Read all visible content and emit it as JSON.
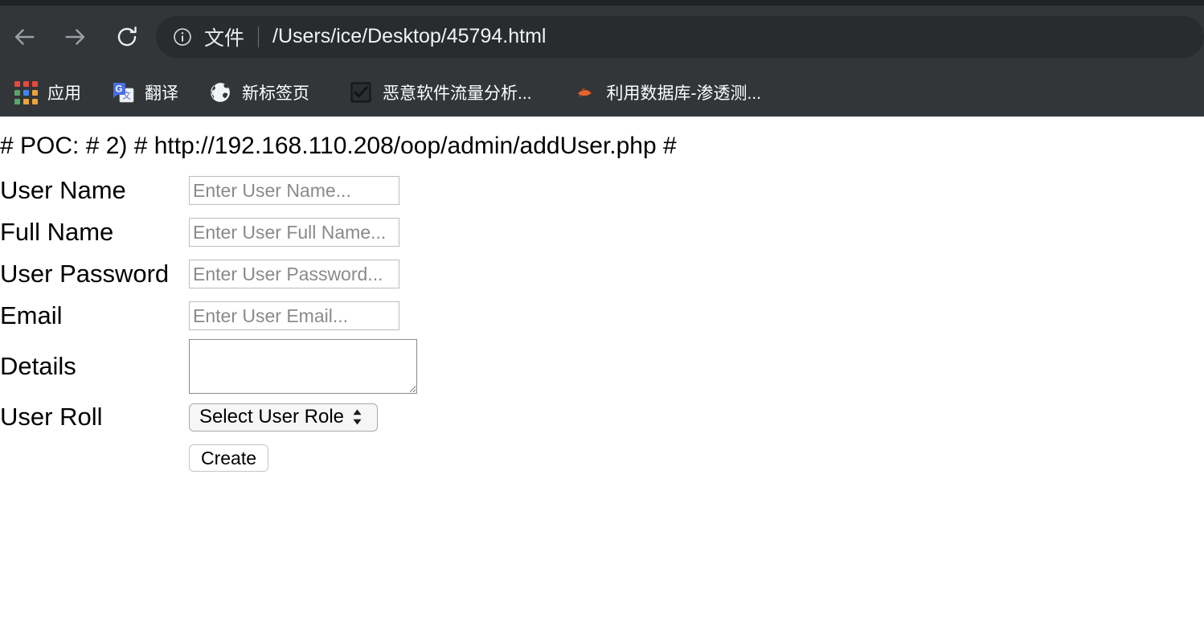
{
  "browser": {
    "nav": {
      "back_label": "Back",
      "forward_label": "Forward",
      "reload_label": "Reload"
    },
    "omnibox": {
      "info_icon": "info-circle-icon",
      "scheme_label": "文件",
      "url": "/Users/ice/Desktop/45794.html"
    },
    "bookmarks": [
      {
        "icon": "apps-grid-icon",
        "label": "应用"
      },
      {
        "icon": "google-translate-icon",
        "label": "翻译"
      },
      {
        "icon": "globe-icon",
        "label": "新标签页"
      },
      {
        "icon": "checkbox-checked-icon",
        "label": "恶意软件流量分析..."
      },
      {
        "icon": "orange-flame-icon",
        "label": "利用数据库-渗透测..."
      }
    ]
  },
  "page": {
    "heading": "# POC: # 2) # http://192.168.110.208/oop/admin/addUser.php #",
    "fields": [
      {
        "label": "User Name",
        "placeholder": "Enter User Name...",
        "value": "",
        "type": "text"
      },
      {
        "label": "Full Name",
        "placeholder": "Enter User Full Name...",
        "value": "",
        "type": "text"
      },
      {
        "label": "User Password",
        "placeholder": "Enter User Password...",
        "value": "",
        "type": "text"
      },
      {
        "label": "Email",
        "placeholder": "Enter User Email...",
        "value": "",
        "type": "text"
      }
    ],
    "details": {
      "label": "Details",
      "value": "",
      "placeholder": ""
    },
    "user_roll": {
      "label": "User Roll",
      "selected": "Select User Role"
    },
    "submit": {
      "label": "Create"
    }
  },
  "colors": {
    "chrome_bg": "#323639",
    "titlebar": "#202324",
    "omnibox_bg": "#292c2e",
    "text_on_chrome": "#ffffff",
    "page_bg": "#ffffff",
    "placeholder": "#8a8a8a",
    "apps_icon": [
      "#e8483c",
      "#e8483c",
      "#e8483c",
      "#57a868",
      "#4285f4",
      "#eba33a",
      "#57a868",
      "#eba33a",
      "#eba33a"
    ],
    "translate_blue": "#4a6ee0",
    "flame_orange": "#e8642a"
  }
}
